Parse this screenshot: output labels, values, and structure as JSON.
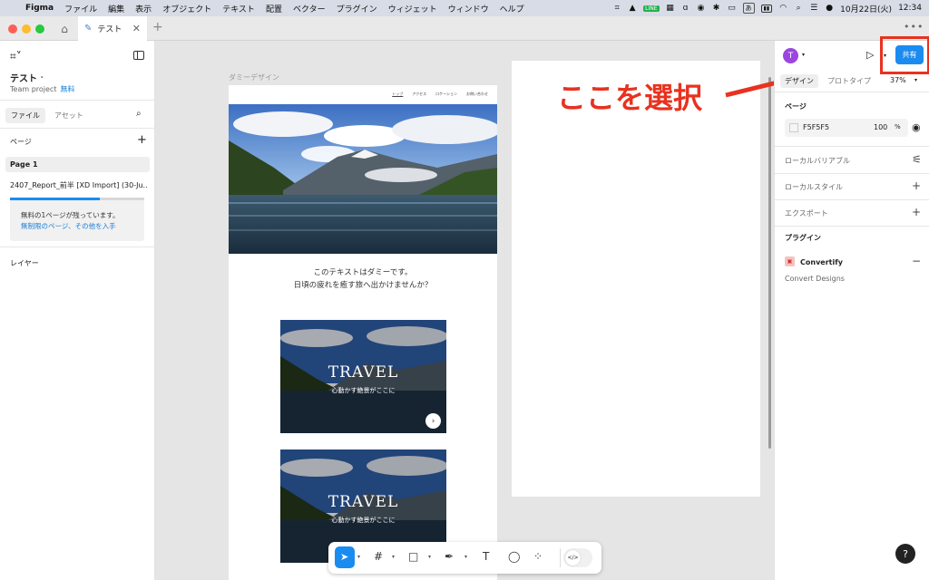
{
  "menubar": {
    "app_name": "Figma",
    "menus": [
      "ファイル",
      "編集",
      "表示",
      "オブジェクト",
      "テキスト",
      "配置",
      "ベクター",
      "プラグイン",
      "ウィジェット",
      "ウィンドウ",
      "ヘルプ"
    ],
    "line_badge": "LINE",
    "input_mode": "あ",
    "datetime": "10月22日(火)",
    "time": "12:34"
  },
  "tabbar": {
    "tab_title": "テスト"
  },
  "left_panel": {
    "file_name": "テスト",
    "team": "Team project",
    "plan_badge": "無料",
    "tab_file": "ファイル",
    "tab_assets": "アセット",
    "pages_title": "ページ",
    "pages": [
      "Page 1",
      "2407_Report_前半 [XD Import] (30-Ju..."
    ],
    "promo_progress": 0.67,
    "promo_text": "無料の1ページが残っています。",
    "promo_link": "無制限のページ、その他を入手",
    "layers_title": "レイヤー"
  },
  "canvas": {
    "frame_label": "ダミーデザイン",
    "nav_links": [
      "トップ",
      "アクセス",
      "ロケーション",
      "お問い合わせ"
    ],
    "dummy_text": [
      "このテキストはダミーです。",
      "日頃の疲れを癒す旅へ出かけませんか？"
    ],
    "cards": [
      {
        "title": "TRAVEL",
        "subtitle": "心動かす絶景がここに"
      },
      {
        "title": "TRAVEL",
        "subtitle": "心動かす絶景がここに"
      }
    ],
    "annotation": "ここを選択"
  },
  "right_panel": {
    "avatar_initial": "T",
    "share_label": "共有",
    "tab_design": "デザイン",
    "tab_prototype": "プロトタイプ",
    "zoom": "37%",
    "page_section": "ページ",
    "bg_color": "F5F5F5",
    "bg_opacity": "100",
    "percent": "%",
    "local_variables": "ローカルバリアブル",
    "local_styles": "ローカルスタイル",
    "export": "エクスポート",
    "plugins": "プラグイン",
    "plugin_name": "Convertify",
    "plugin_sub": "Convert Designs",
    "help": "?"
  },
  "colors": {
    "accent": "#1a8cf0",
    "annotation": "#e8321f",
    "avatar": "#9b46e0"
  }
}
